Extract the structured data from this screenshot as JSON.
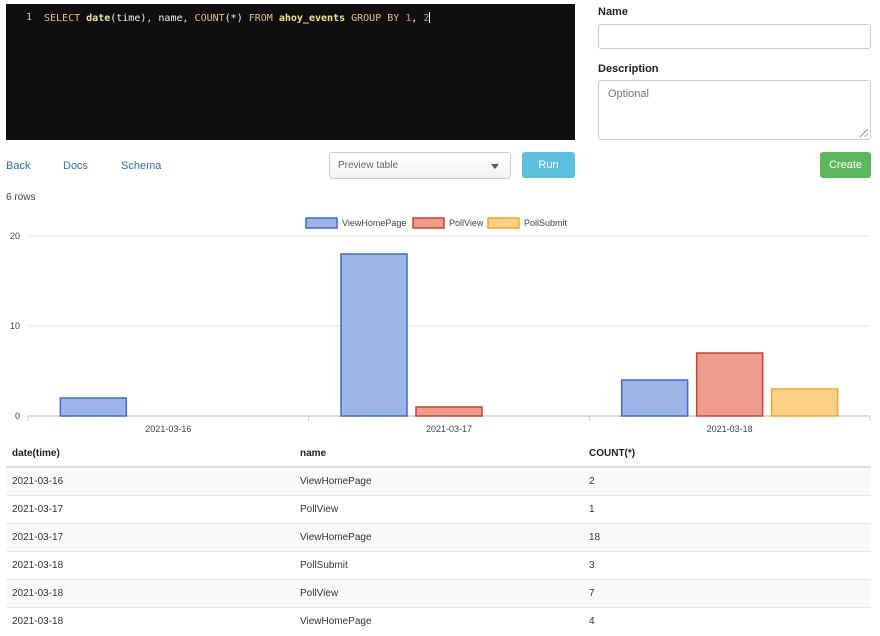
{
  "editor": {
    "line_number": "1",
    "tokens": {
      "select": "SELECT",
      "date_fn": "date",
      "date_args": "(time), name, ",
      "count_fn": "COUNT",
      "count_args": "(*) ",
      "from": "FROM",
      "table": " ahoy_events ",
      "group_by": "GROUP BY",
      "n1": " 1",
      "comma": ", ",
      "n2": "2"
    }
  },
  "form": {
    "name_label": "Name",
    "description_label": "Description",
    "description_placeholder": "Optional"
  },
  "toolbar": {
    "back": "Back",
    "docs": "Docs",
    "schema": "Schema",
    "preview_select": "Preview table",
    "run": "Run",
    "create": "Create"
  },
  "results": {
    "row_count": "6 rows",
    "columns": [
      "date(time)",
      "name",
      "COUNT(*)"
    ],
    "rows": [
      [
        "2021-03-16",
        "ViewHomePage",
        "2"
      ],
      [
        "2021-03-17",
        "PollView",
        "1"
      ],
      [
        "2021-03-17",
        "ViewHomePage",
        "18"
      ],
      [
        "2021-03-18",
        "PollSubmit",
        "3"
      ],
      [
        "2021-03-18",
        "PollView",
        "7"
      ],
      [
        "2021-03-18",
        "ViewHomePage",
        "4"
      ]
    ]
  },
  "colors": {
    "accent_run": "#5bc0de",
    "accent_create": "#5cb85c",
    "link": "#2a6fbb"
  },
  "chart_data": {
    "type": "bar",
    "categories": [
      "2021-03-16",
      "2021-03-17",
      "2021-03-18"
    ],
    "series": [
      {
        "name": "ViewHomePage",
        "values": [
          2,
          18,
          4
        ],
        "fill": "#9db5e6",
        "stroke": "#3c6ccf"
      },
      {
        "name": "PollView",
        "values": [
          0,
          1,
          7
        ],
        "fill": "#ed9c8e",
        "stroke": "#d0402e"
      },
      {
        "name": "PollSubmit",
        "values": [
          0,
          0,
          3
        ],
        "fill": "#fdd086",
        "stroke": "#f2a928"
      }
    ],
    "yticks": [
      0,
      10,
      20
    ],
    "ylim": [
      0,
      20
    ],
    "legend_position": "top",
    "grid": true
  }
}
